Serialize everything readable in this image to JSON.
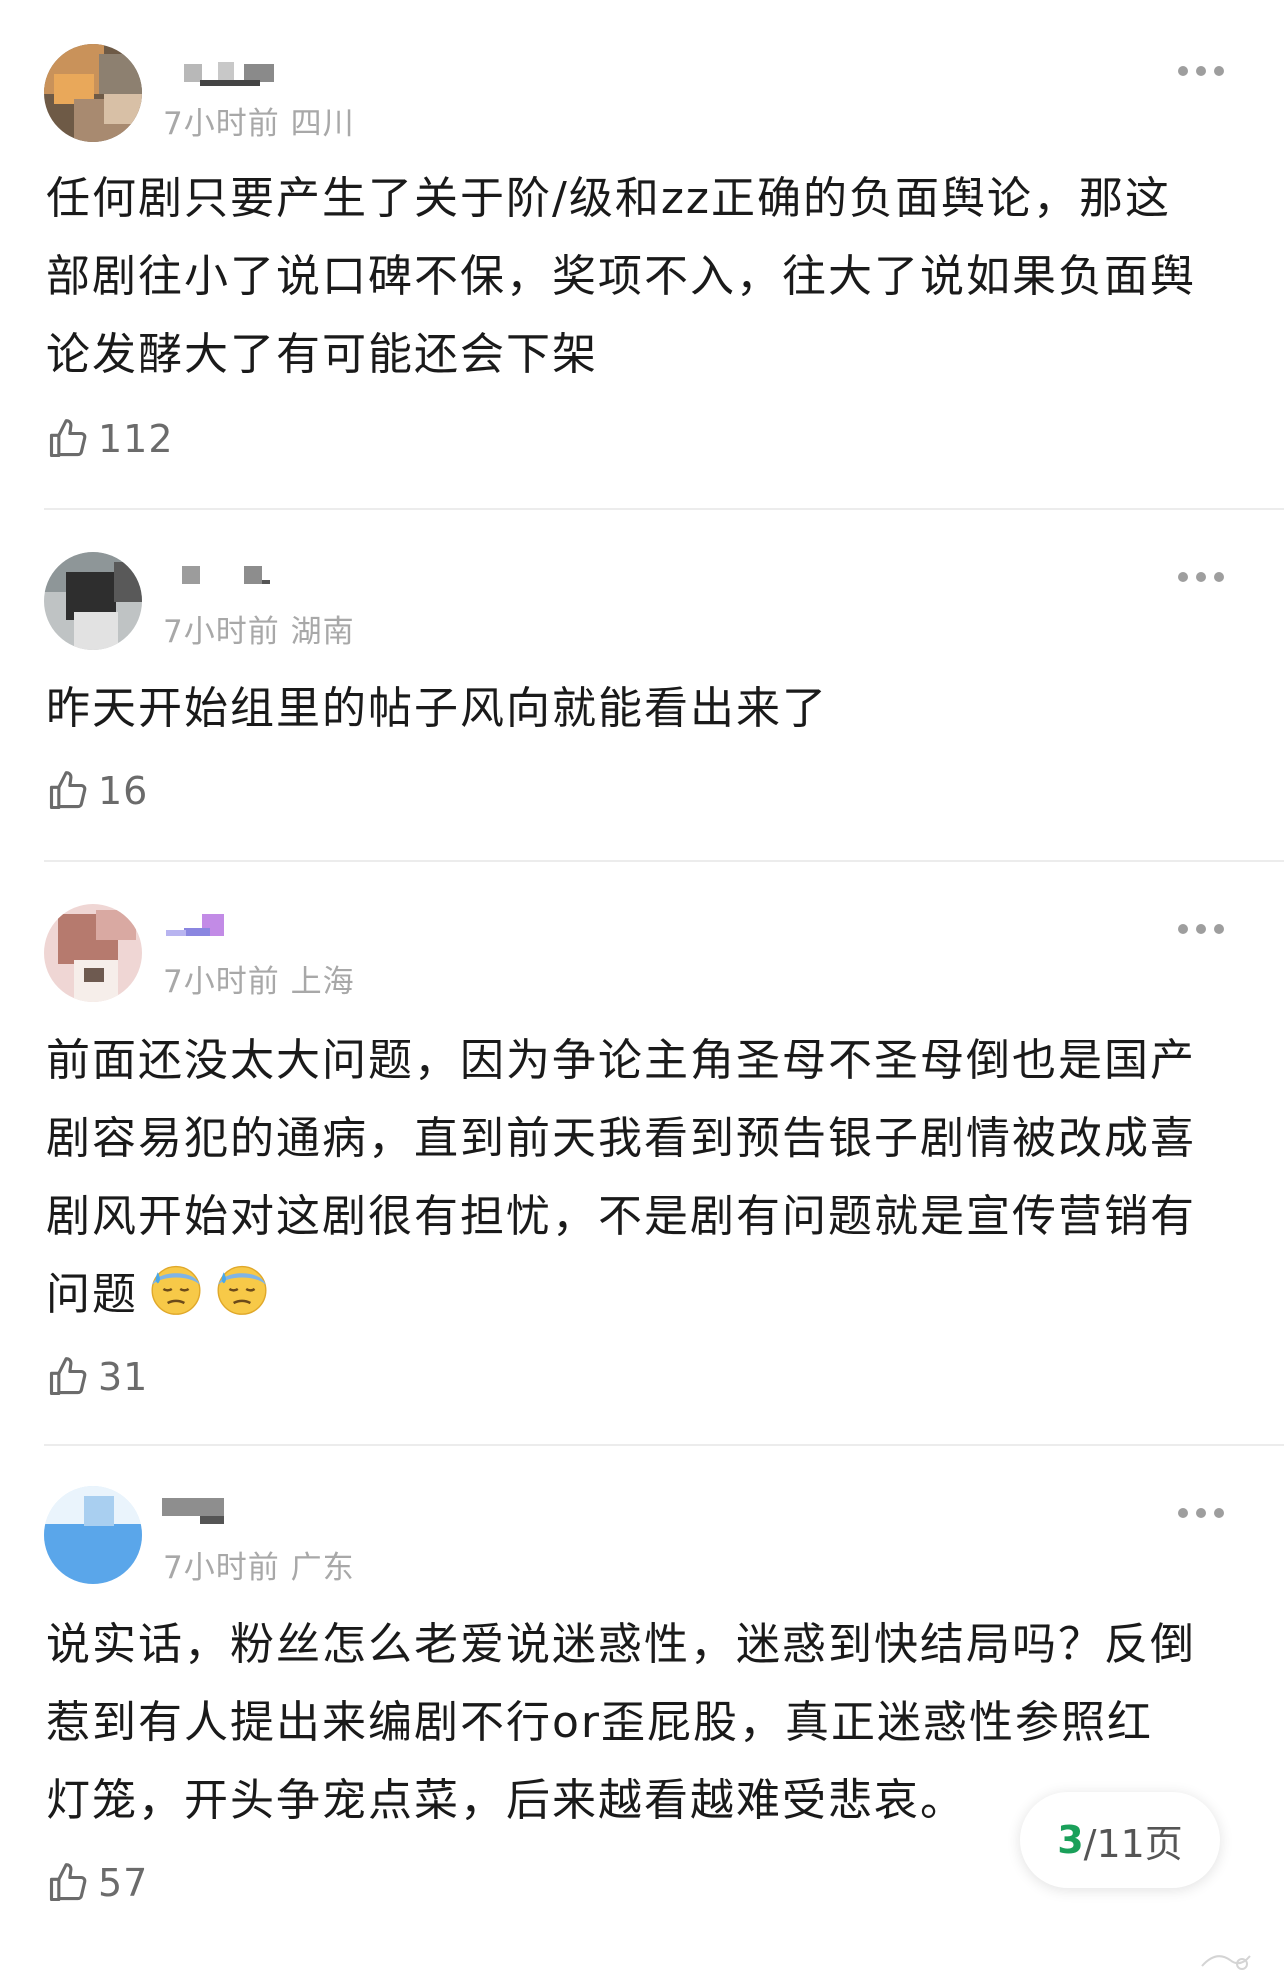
{
  "comments": [
    {
      "meta": "7小时前 四川",
      "text_lines": [
        "任何剧只要产生了关于阶/级和zz正确的负面舆论，那这",
        "部剧往小了说口碑不保，奖项不入，往大了说如果负面舆",
        "论发酵大了有可能还会下架"
      ],
      "likes": "112"
    },
    {
      "meta": "7小时前 湖南",
      "text_lines": [
        "昨天开始组里的帖子风向就能看出来了"
      ],
      "likes": "16"
    },
    {
      "meta": "7小时前 上海",
      "text_lines": [
        "前面还没太大问题，因为争论主角圣母不圣母倒也是国产",
        "剧容易犯的通病，直到前天我看到预告银子剧情被改成喜",
        "剧风开始对这剧很有担忧，不是剧有问题就是宣传营销有",
        "问题"
      ],
      "likes": "31"
    },
    {
      "meta": "7小时前 广东",
      "text_lines": [
        "说实话，粉丝怎么老爱说迷惑性，迷惑到快结局吗？反倒",
        "惹到有人提出来编剧不行or歪屁股，真正迷惑性参照红",
        "灯笼，开头争宠点菜，后来越看越难受悲哀。"
      ],
      "likes": "57"
    }
  ],
  "pager": {
    "current": "3",
    "total_text": "/11页"
  },
  "colors": {
    "accent_green": "#1aa05a",
    "meta_gray": "#a8a8a8",
    "divider": "#ececec"
  },
  "icons": {
    "like": "thumbs-up-icon",
    "more": "more-dots-icon",
    "emoji": "downcast-face-with-sweat-emoji"
  }
}
